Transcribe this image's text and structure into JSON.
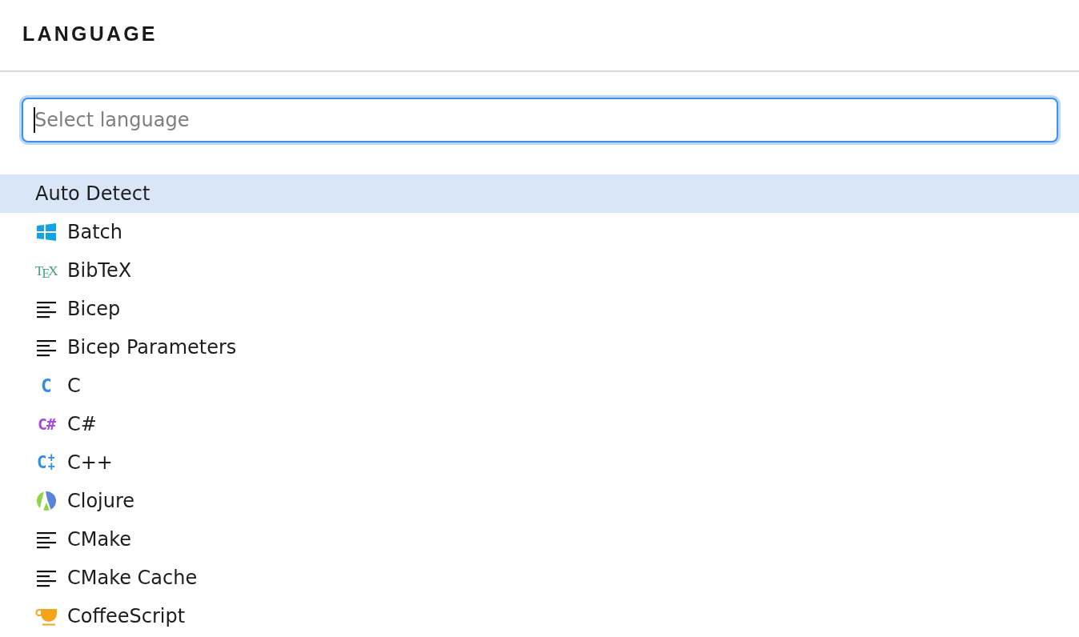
{
  "header": {
    "title": "LANGUAGE"
  },
  "search": {
    "placeholder": "Select language",
    "focused": true
  },
  "languages": [
    {
      "label": "Auto Detect",
      "kind": "none",
      "selected": true
    },
    {
      "label": "Batch",
      "kind": "windows",
      "selected": false
    },
    {
      "label": "BibTeX",
      "kind": "tex",
      "icon_text": "TEX",
      "selected": false
    },
    {
      "label": "Bicep",
      "kind": "lines",
      "selected": false
    },
    {
      "label": "Bicep Parameters",
      "kind": "lines",
      "selected": false
    },
    {
      "label": "C",
      "kind": "c",
      "icon_text": "C",
      "selected": false
    },
    {
      "label": "C#",
      "kind": "csharp",
      "icon_text": "C#",
      "selected": false
    },
    {
      "label": "C++",
      "kind": "cpp",
      "icon_text": "C++",
      "selected": false
    },
    {
      "label": "Clojure",
      "kind": "clojure",
      "selected": false
    },
    {
      "label": "CMake",
      "kind": "lines",
      "selected": false
    },
    {
      "label": "CMake Cache",
      "kind": "lines",
      "selected": false
    },
    {
      "label": "CoffeeScript",
      "kind": "coffee",
      "selected": false
    }
  ]
}
